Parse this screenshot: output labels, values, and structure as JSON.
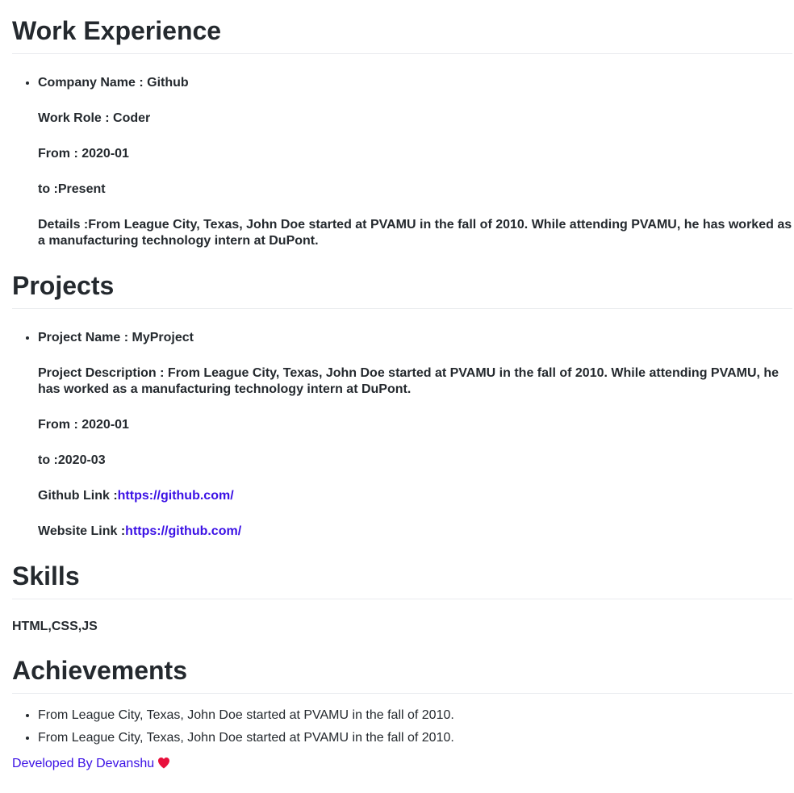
{
  "work": {
    "title": "Work Experience",
    "company_line": "Company Name : Github",
    "role_line": "Work Role : Coder",
    "from_line": "From : 2020-01",
    "to_line": "to :Present",
    "details_line": "Details :From League City, Texas, John Doe started at PVAMU in the fall of 2010. While attending PVAMU, he has worked as a manufacturing technology intern at DuPont."
  },
  "projects": {
    "title": "Projects",
    "name_line": "Project Name : MyProject",
    "description_line": "Project Description : From League City, Texas, John Doe started at PVAMU in the fall of 2010. While attending PVAMU, he has worked as a manufacturing technology intern at DuPont.",
    "from_line": "From : 2020-01",
    "to_line": "to :2020-03",
    "github_label": "Github Link :",
    "github_url": "https://github.com/",
    "website_label": "Website Link :",
    "website_url": "https://github.com/"
  },
  "skills": {
    "title": "Skills",
    "list": "HTML,CSS,JS"
  },
  "achievements": {
    "title": "Achievements",
    "items": [
      "From League City, Texas, John Doe started at PVAMU in the fall of 2010.",
      "From League City, Texas, John Doe started at PVAMU in the fall of 2010."
    ]
  },
  "footer": {
    "text": "Developed By Devanshu",
    "icon": "heart-icon",
    "link_color": "#3a10e5",
    "heart_color": "#e8103c"
  }
}
